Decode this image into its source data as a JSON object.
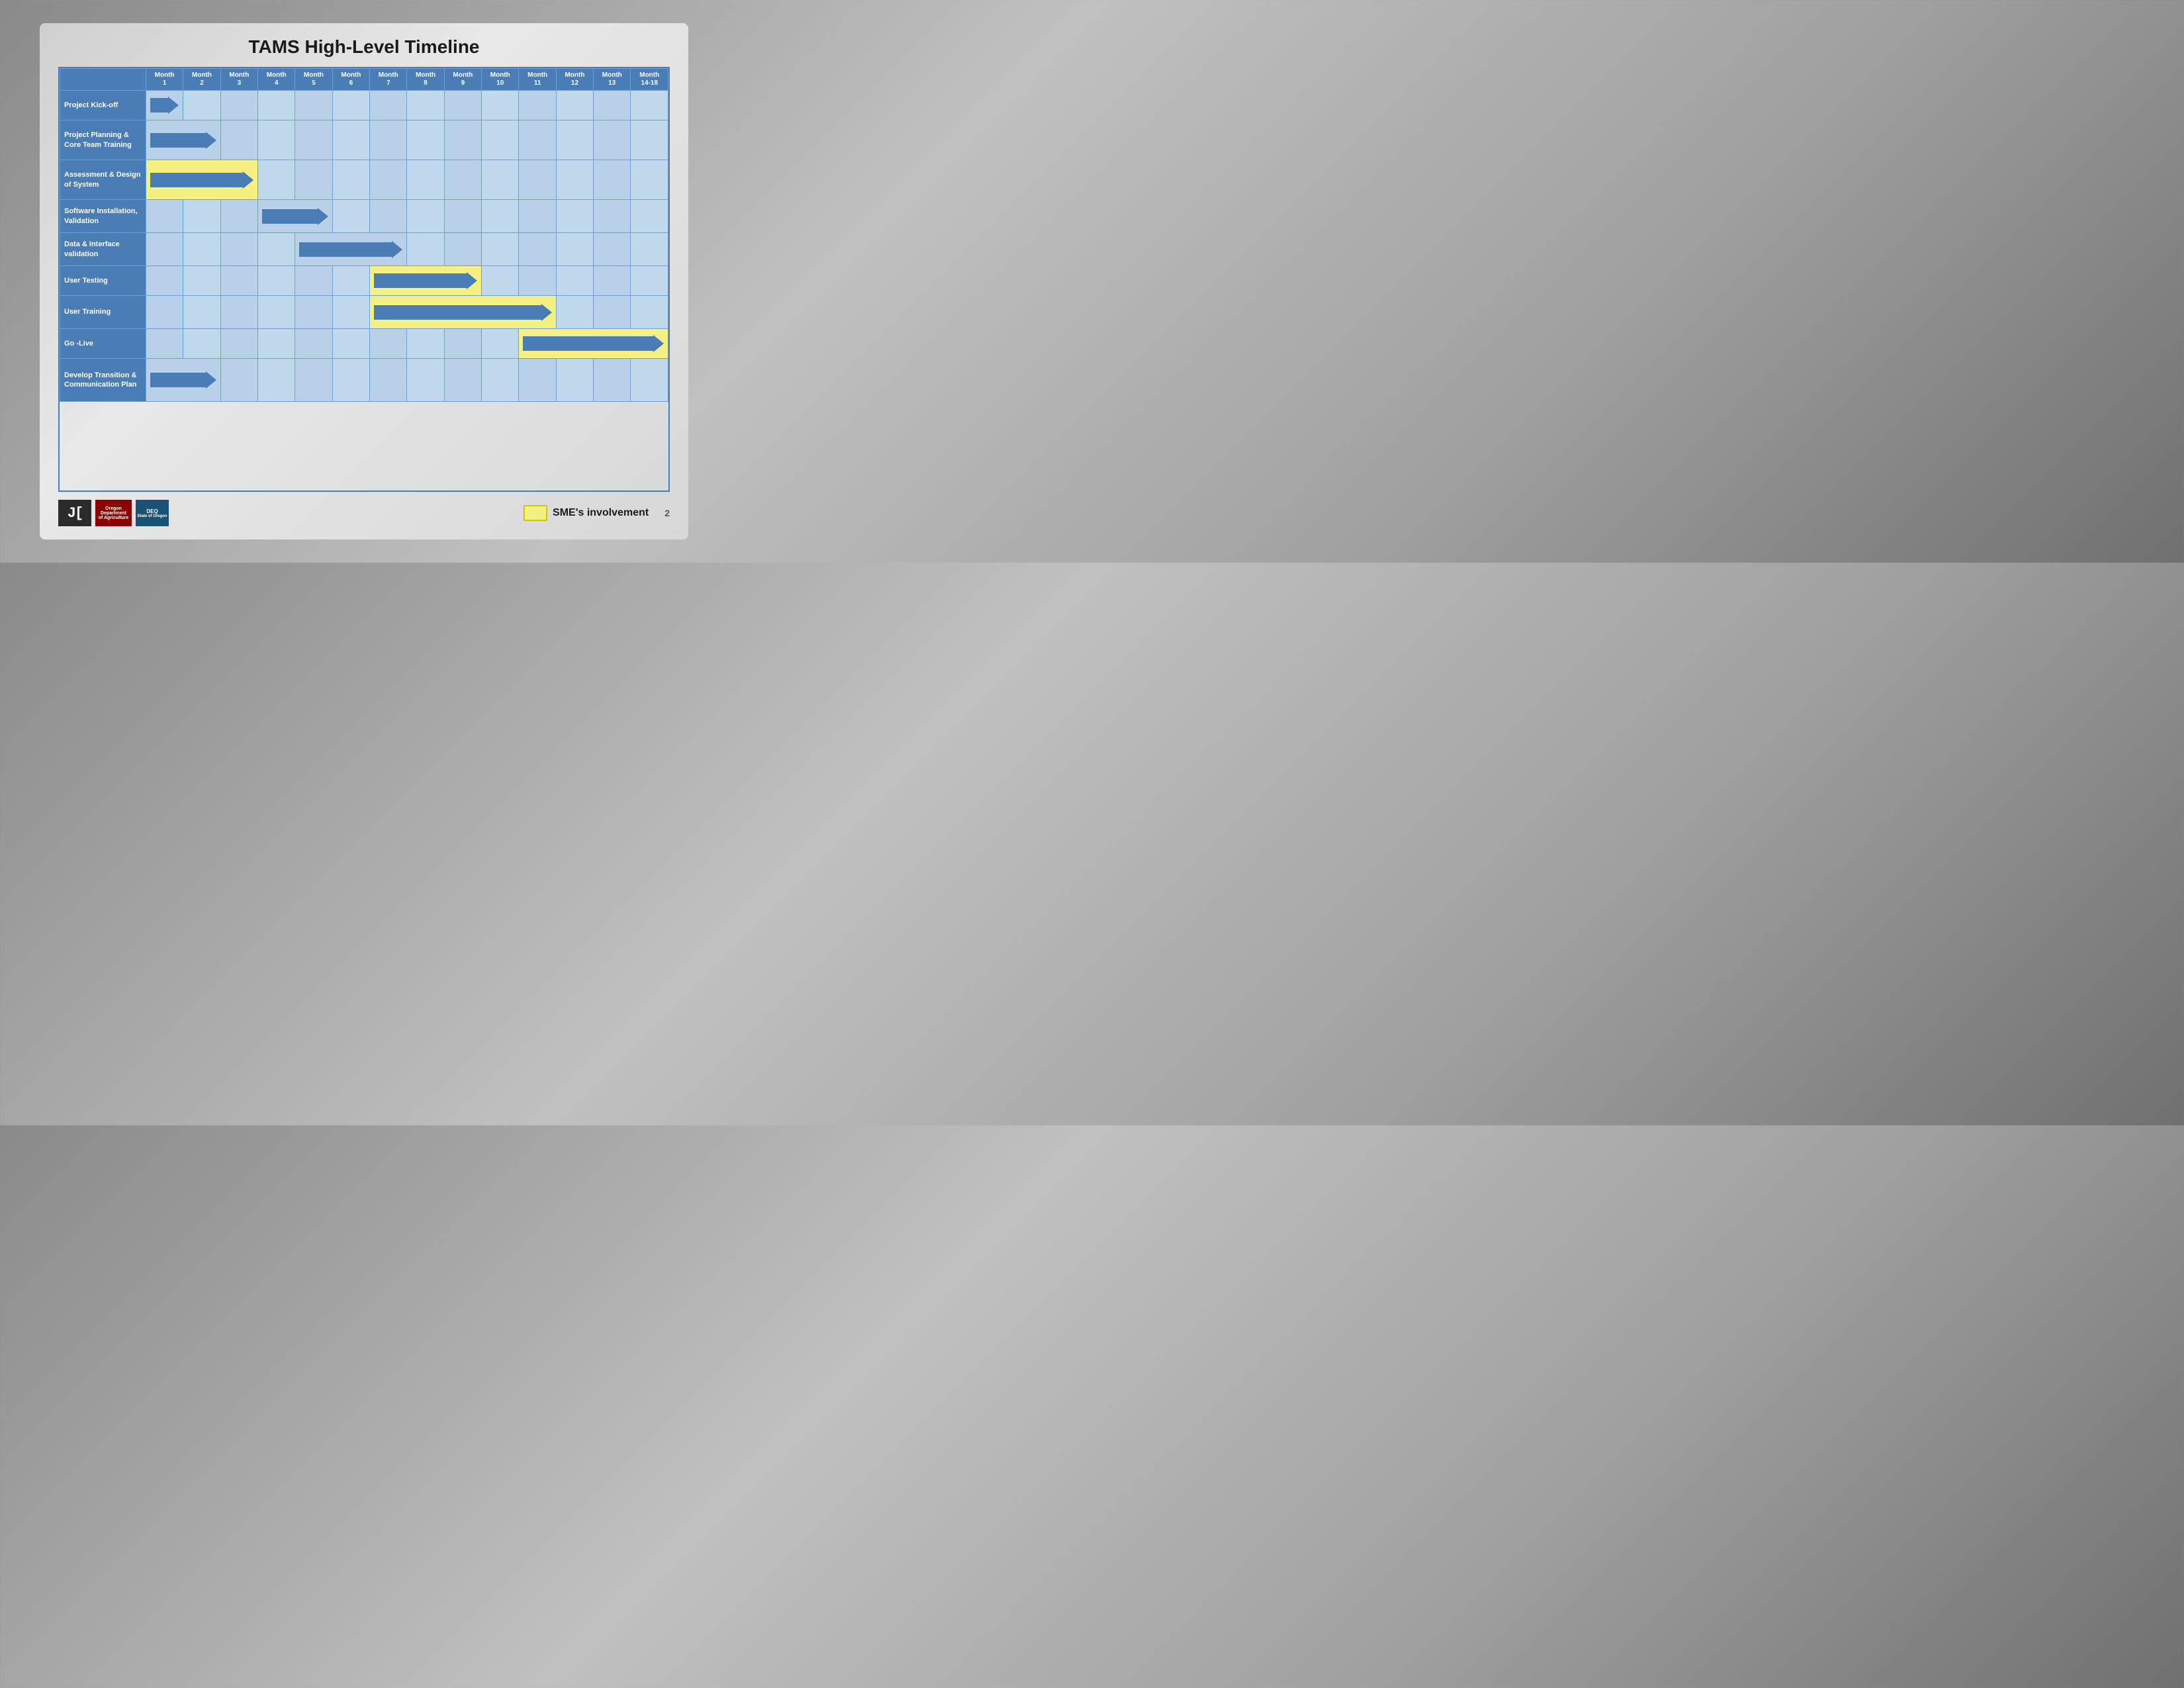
{
  "title": "TAMS High-Level Timeline",
  "columns": [
    "Month 1",
    "Month 2",
    "Month 3",
    "Month 4",
    "Month 5",
    "Month 6",
    "Month 7",
    "Month 8",
    "Month 9",
    "Month 10",
    "Month 11",
    "Month 12",
    "Month 13",
    "Month 14-18"
  ],
  "rows": [
    {
      "label": "Project Kick-off",
      "sme": false,
      "arrow_start": 0,
      "arrow_span": 1
    },
    {
      "label": "Project Planning & Core Team Training",
      "sme": false,
      "arrow_start": 0,
      "arrow_span": 2
    },
    {
      "label": "Assessment & Design of System",
      "sme": true,
      "arrow_start": 0,
      "arrow_span": 3
    },
    {
      "label": "Software Installation, Validation",
      "sme": false,
      "arrow_start": 3,
      "arrow_span": 2
    },
    {
      "label": "Data & Interface validation",
      "sme": false,
      "arrow_start": 4,
      "arrow_span": 3
    },
    {
      "label": "User Testing",
      "sme": true,
      "arrow_start": 6,
      "arrow_span": 3
    },
    {
      "label": "User Training",
      "sme": true,
      "arrow_start": 6,
      "arrow_span": 5
    },
    {
      "label": "Go -Live",
      "sme": true,
      "arrow_start": 10,
      "arrow_span": 4
    },
    {
      "label": "Develop Transition & Communication Plan",
      "sme": false,
      "arrow_start": 0,
      "arrow_span": 2
    }
  ],
  "legend": {
    "label": "SME's involvement",
    "box_color": "#f5f082"
  },
  "footer": {
    "page_number": "2"
  }
}
